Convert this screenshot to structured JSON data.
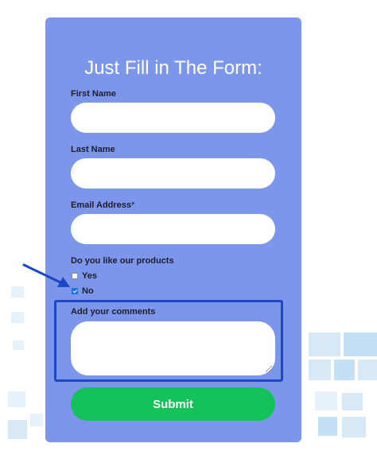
{
  "form": {
    "title": "Just Fill in The Form:",
    "first_name": {
      "label": "First Name",
      "value": ""
    },
    "last_name": {
      "label": "Last Name",
      "value": ""
    },
    "email": {
      "label": "Email Address",
      "required_mark": "*",
      "value": ""
    },
    "question": {
      "label": "Do you like our products",
      "options": [
        {
          "label": "Yes",
          "checked": false
        },
        {
          "label": "No",
          "checked": true
        }
      ]
    },
    "comments": {
      "label": "Add your comments",
      "value": ""
    },
    "submit_label": "Submit"
  },
  "colors": {
    "card": "#7b96ea",
    "submit": "#13c35a",
    "annotation": "#1e47c8"
  },
  "icons": [
    "arrow-annotation-icon",
    "checkbox-icon",
    "resize-handle-icon"
  ]
}
